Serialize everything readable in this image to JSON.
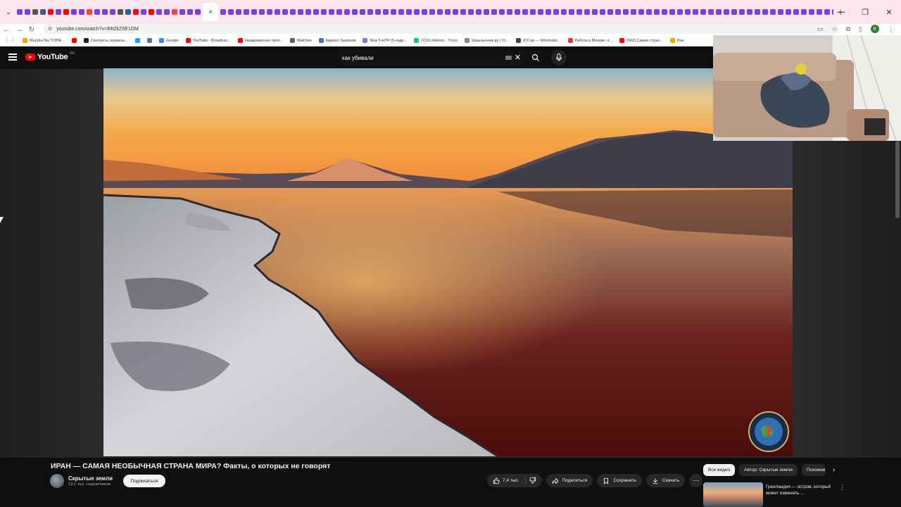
{
  "browser": {
    "url": "youtube.com/watch?v=lMtZkZ6E1DM",
    "tab_close": "×",
    "new_tab": "+",
    "controls": {
      "minimize": "—",
      "restore": "❐",
      "close": "✕"
    },
    "bookmarks": [
      {
        "label": "Muzyka Na TOPIE...",
        "color": "#f4a900"
      },
      {
        "label": "",
        "color": "#ff0000"
      },
      {
        "label": "Смотреть сериалы...",
        "color": "#222222"
      },
      {
        "label": "",
        "color": "#1da1f2"
      },
      {
        "label": "",
        "color": "#4a76a8"
      },
      {
        "label": "Google",
        "color": "#4285f4"
      },
      {
        "label": "YouTube - Broadcas...",
        "color": "#ff0000"
      },
      {
        "label": "Неадекватное прох...",
        "color": "#ff0000"
      },
      {
        "label": "Matches",
        "color": "#556677"
      },
      {
        "label": "Кирилл Зырянов",
        "color": "#4a76a8"
      },
      {
        "label": "Now 5-HTP (5-гидр...",
        "color": "#8a7ccf"
      },
      {
        "label": "(1)ViLinkHoro - Trovo",
        "color": "#19c37d"
      },
      {
        "label": "Шашлычник.ру | Ус...",
        "color": "#888888"
      },
      {
        "label": "ICCup — Informatio...",
        "color": "#444444"
      },
      {
        "label": "Работа в Москве: п...",
        "color": "#e53935"
      },
      {
        "label": "(562) Самая стран...",
        "color": "#ff0000"
      },
      {
        "label": "Das",
        "color": "#f4a900"
      }
    ],
    "profile_initial": "K"
  },
  "youtube": {
    "logo_text": "YouTube",
    "region": "RU",
    "search": {
      "value": "как убивали"
    }
  },
  "video": {
    "title": "ИРАН — САМАЯ НЕОБЫЧНАЯ СТРАНА МИРА? Факты, о которых не говорят",
    "channel": "Скрытые земли",
    "subscribers": "13,1 тыс. подписчиков",
    "subscribe_label": "Подписаться",
    "likes": "7,4 тыс.",
    "share_label": "Поделиться",
    "save_label": "Сохранить",
    "download_label": "Скачать",
    "more_label": "⋯"
  },
  "sidebar": {
    "chips": [
      "Все видео",
      "Автор: Скрытые земли",
      "Похожие"
    ],
    "chip_next": "›",
    "recommendation": {
      "title": "Гренландия — остров, который может изменить ..."
    }
  },
  "colors": {
    "yt_red": "#ff0000",
    "tabstrip": "#fbe6ef",
    "page_bg": "#0f0f0f"
  }
}
